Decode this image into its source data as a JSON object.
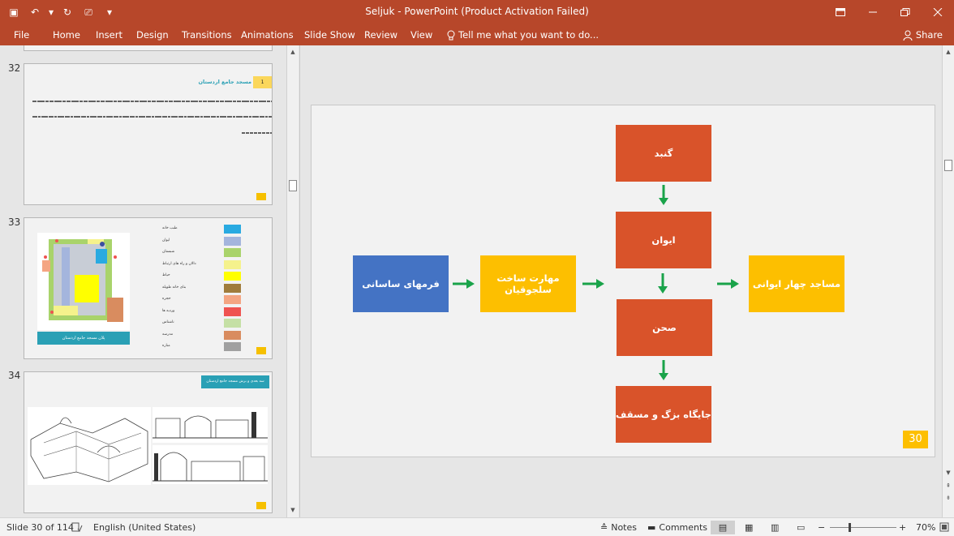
{
  "app": {
    "window_title": "Seljuk - PowerPoint (Product Activation Failed)"
  },
  "quick_access": [
    {
      "name": "save-icon",
      "glyph": "▣"
    },
    {
      "name": "undo-icon",
      "glyph": "↶"
    },
    {
      "name": "undo-dropdown-icon",
      "glyph": "▾"
    },
    {
      "name": "redo-icon",
      "glyph": "↻"
    },
    {
      "name": "start-from-beginning-icon",
      "glyph": "⎚"
    },
    {
      "name": "customize-qat-icon",
      "glyph": "▾"
    }
  ],
  "ribbon": {
    "file": "File",
    "tabs": [
      "Home",
      "Insert",
      "Design",
      "Transitions",
      "Animations",
      "Slide Show",
      "Review",
      "View"
    ],
    "tell_me": "Tell me what you want to do...",
    "share": "Share"
  },
  "thumbnails": [
    {
      "number": "32"
    },
    {
      "number": "33"
    },
    {
      "number": "34"
    }
  ],
  "thumbnail_text": {
    "t32_title": "مسجد جامع اردستان",
    "t32_index": "1",
    "t33_caption": "پلان مسجد جامع اردستان",
    "t34_title": "سه بعدی و برش مسجد جامع اردستان"
  },
  "thumb33_legend": [
    {
      "label": "طبب خانه",
      "color": "#29aae1"
    },
    {
      "label": "ایوان",
      "color": "#a4b5dd"
    },
    {
      "label": "شبستان",
      "color": "#a9d36b"
    },
    {
      "label": "دالان و راه های ارتباط",
      "color": "#f5f28c"
    },
    {
      "label": "حیاط",
      "color": "#ffff00"
    },
    {
      "label": "بنای خانه طویله",
      "color": "#a07c3c"
    },
    {
      "label": "حجره",
      "color": "#f4a582"
    },
    {
      "label": "وردیه ها",
      "color": "#ef5350"
    },
    {
      "label": "ناشناس",
      "color": "#c5e0a5"
    },
    {
      "label": "مدرسه",
      "color": "#d98c5f"
    },
    {
      "label": "مناره",
      "color": "#a0a0a0"
    }
  ],
  "slide": {
    "boxes": {
      "gonbad": "گنبد",
      "ivan": "ایوان",
      "sahn": "صحن",
      "jaygah": "جایگاه بزگ و مسقف",
      "sasani": "فرمهای ساسانی",
      "maharat": "مهارت ساخت سلجوقیان",
      "masajed": "مساجد چهار ایوانی"
    },
    "page_number": "30",
    "colors": {
      "orange": "#d9532a",
      "yellow": "#fdbf00",
      "blue": "#4473c4",
      "arrow": "#1aa34a"
    }
  },
  "status": {
    "slide_of": "Slide 30 of 114",
    "language": "English (United States)",
    "notes": "Notes",
    "comments": "Comments",
    "zoom": "70%"
  }
}
